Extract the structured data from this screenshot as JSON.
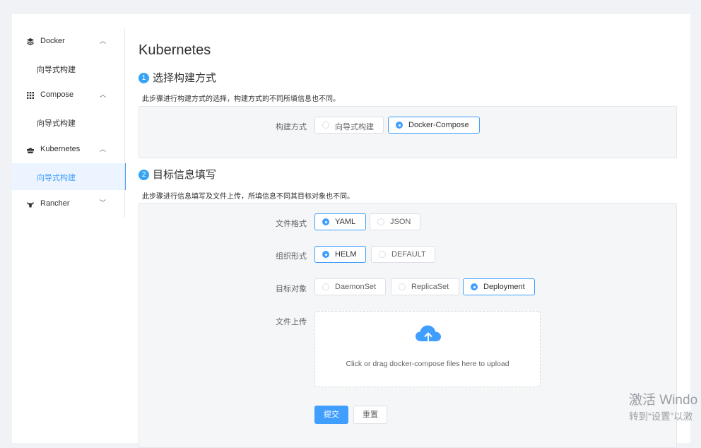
{
  "sidebar": {
    "groups": [
      {
        "label": "Docker",
        "icon": "layers-icon",
        "expanded": true,
        "items": [
          "向导式构建"
        ]
      },
      {
        "label": "Compose",
        "icon": "grid-icon",
        "expanded": true,
        "items": [
          "向导式构建"
        ]
      },
      {
        "label": "Kubernetes",
        "icon": "ship-icon",
        "expanded": true,
        "items": [
          "向导式构建"
        ]
      },
      {
        "label": "Rancher",
        "icon": "bull-icon",
        "expanded": false,
        "items": []
      }
    ],
    "active_item": "Kubernetes / 向导式构建"
  },
  "main": {
    "title": "Kubernetes",
    "step1": {
      "number": "1",
      "title": "选择构建方式",
      "desc": "此步骤进行构建方式的选择，构建方式的不同所填信息也不同。",
      "label": "构建方式",
      "options": [
        "向导式构建",
        "Docker-Compose"
      ],
      "selected": "Docker-Compose"
    },
    "step2": {
      "number": "2",
      "title": "目标信息填写",
      "desc": "此步骤进行信息填写及文件上传，所填信息不同其目标对象也不同。",
      "format": {
        "label": "文件格式",
        "options": [
          "YAML",
          "JSON"
        ],
        "selected": "YAML"
      },
      "org": {
        "label": "组织形式",
        "options": [
          "HELM",
          "DEFAULT"
        ],
        "selected": "HELM"
      },
      "target": {
        "label": "目标对象",
        "options": [
          "DaemonSet",
          "ReplicaSet",
          "Deployment"
        ],
        "selected": "Deployment"
      },
      "upload": {
        "label": "文件上传",
        "text": "Click or drag docker-compose files here to upload",
        "icon": "cloud-upload-icon"
      },
      "submit": "提交",
      "reset": "重置"
    }
  },
  "watermark": {
    "line1": "激活 Windo",
    "line2": "转到“设置”以激"
  },
  "colors": {
    "accent": "#409eff",
    "step_badge": "#36a3f7",
    "active_bg": "#ecf5ff"
  }
}
